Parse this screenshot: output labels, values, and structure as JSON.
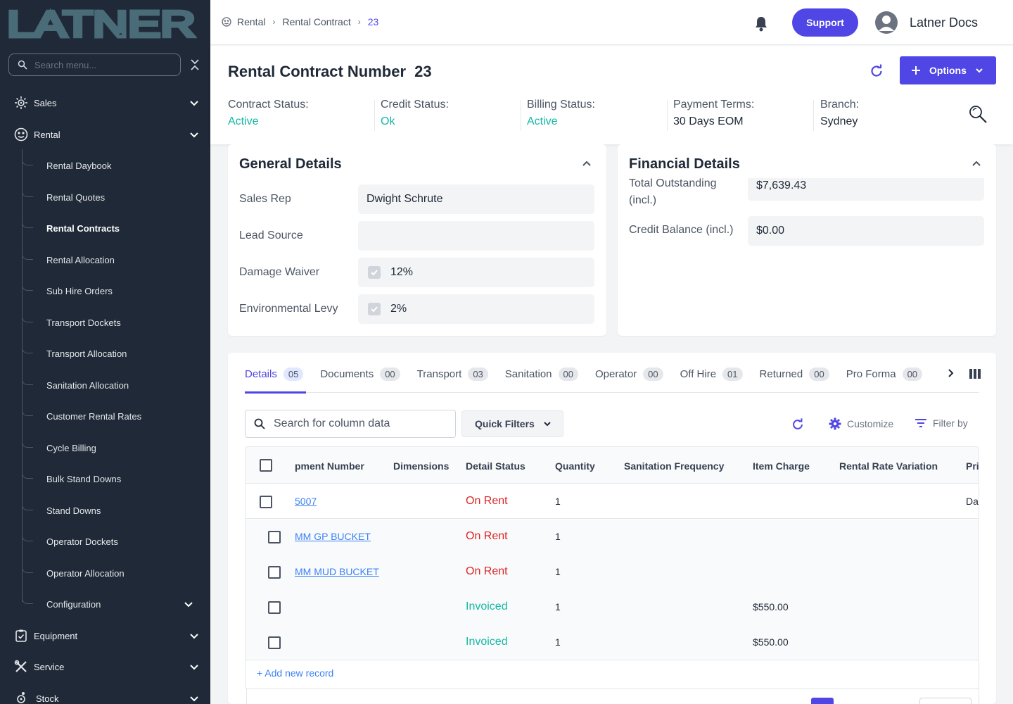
{
  "sidebar": {
    "logo_text": "LATNER",
    "search_placeholder": "Search menu...",
    "top_items": {
      "sales": "Sales",
      "rental": "Rental",
      "equipment": "Equipment",
      "service": "Service",
      "stock": "Stock"
    },
    "rental_items": [
      "Rental Daybook",
      "Rental Quotes",
      "Rental Contracts",
      "Rental Allocation",
      "Sub Hire Orders",
      "Transport Dockets",
      "Transport Allocation",
      "Sanitation Allocation",
      "Customer Rental Rates",
      "Cycle Billing",
      "Bulk Stand Downs",
      "Stand Downs",
      "Operator Dockets",
      "Operator Allocation",
      "Configuration"
    ],
    "active_item": "Rental Contracts"
  },
  "topbar": {
    "breadcrumb": [
      "Rental",
      "Rental Contract",
      "23"
    ],
    "support_label": "Support",
    "user_name": "Latner Docs"
  },
  "contract": {
    "title_label": "Rental Contract Number",
    "number": "23",
    "options_label": "Options",
    "statuses": [
      {
        "key": "Contract Status:",
        "value": "Active"
      },
      {
        "key": "Credit Status:",
        "value": "Ok"
      },
      {
        "key": "Billing Status:",
        "value": "Active"
      },
      {
        "key": "Payment Terms:",
        "value": "30 Days EOM"
      },
      {
        "key": "Branch:",
        "value": "Sydney"
      }
    ]
  },
  "general": {
    "title": "General Details",
    "sales_rep_label": "Sales Rep",
    "sales_rep_value": "Dwight Schrute",
    "lead_source_label": "Lead Source",
    "lead_source_value": "",
    "damage_waiver_label": "Damage Waiver",
    "damage_waiver_value": "12%",
    "env_levy_label": "Environmental Levy",
    "env_levy_value": "2%"
  },
  "financial": {
    "title": "Financial Details",
    "total_outstanding_label": "Total Outstanding (incl.)",
    "total_outstanding_value": "$7,639.43",
    "credit_balance_label": "Credit Balance (incl.)",
    "credit_balance_value": "$0.00"
  },
  "tabs": [
    {
      "label": "Details",
      "count": "05"
    },
    {
      "label": "Documents",
      "count": "00"
    },
    {
      "label": "Transport",
      "count": "03"
    },
    {
      "label": "Sanitation",
      "count": "00"
    },
    {
      "label": "Operator",
      "count": "00"
    },
    {
      "label": "Off Hire",
      "count": "01"
    },
    {
      "label": "Returned",
      "count": "00"
    },
    {
      "label": "Pro Forma",
      "count": "00"
    }
  ],
  "toolbar": {
    "search_placeholder": "Search for column data",
    "quick_filters_label": "Quick Filters",
    "customize_label": "Customize",
    "filter_by_label": "Filter by"
  },
  "grid": {
    "columns": [
      "pment Number",
      "Dimensions",
      "Detail Status",
      "Quantity",
      "Sanitation Frequency",
      "Item Charge",
      "Rental Rate Variation",
      "Pri"
    ],
    "rows": [
      {
        "number": "5007",
        "status": "On Rent",
        "qty": "1",
        "charge": "",
        "extra": "Da"
      },
      {
        "number": "MM GP BUCKET",
        "status": "On Rent",
        "qty": "1",
        "charge": "",
        "extra": ""
      },
      {
        "number": "MM MUD BUCKET",
        "status": "On Rent",
        "qty": "1",
        "charge": "",
        "extra": ""
      },
      {
        "number": "",
        "status": "Invoiced",
        "qty": "1",
        "charge": "$550.00",
        "extra": ""
      },
      {
        "number": "",
        "status": "Invoiced",
        "qty": "1",
        "charge": "$550.00",
        "extra": ""
      }
    ],
    "add_record_label": "+ Add new record"
  },
  "colors": {
    "accent": "#4f46e5",
    "sidebar_bg": "#1f2937",
    "status_teal": "#14b8a6",
    "status_red": "#dc2626",
    "link_blue": "#3b82f6"
  }
}
